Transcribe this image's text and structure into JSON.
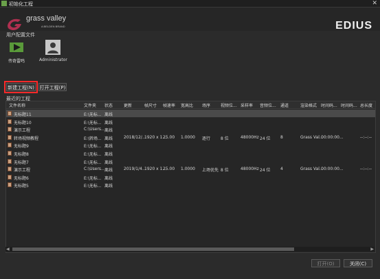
{
  "window": {
    "title": "初始化工程",
    "close": "✕"
  },
  "brand": {
    "name": "grass valley",
    "sub": "A BELDEN BRAND",
    "product": "EDIUS"
  },
  "profiles": {
    "section_label": "用户配置文件",
    "items": [
      {
        "label": "传奇雷鸣"
      },
      {
        "label": "Administrator"
      }
    ]
  },
  "actions": {
    "new_project": "新建工程(N)",
    "open_project": "打开工程(P)"
  },
  "recent": {
    "section_label": "最近的工程",
    "columns": [
      "文件名称",
      "文件夹",
      "状态",
      "更新",
      "帧尺寸",
      "帧速率",
      "宽高比",
      "场序",
      "视频位...",
      "采样率",
      "音频位...",
      "通道",
      "渲染格式",
      "时间码...",
      "时间码...",
      "总长度"
    ],
    "rows": [
      {
        "name": "无标题11",
        "folder": "E:\\无标...",
        "status": "离线",
        "updated": "",
        "frame": "",
        "rate": "",
        "aspect": "",
        "field": "",
        "vbit": "",
        "sample": "",
        "abit": "",
        "ch": "",
        "render": "",
        "tc1": "",
        "tc2": "",
        "total": ""
      },
      {
        "name": "无标题10",
        "folder": "E:\\无标...",
        "status": "离线",
        "updated": "",
        "frame": "",
        "rate": "",
        "aspect": "",
        "field": "",
        "vbit": "",
        "sample": "",
        "abit": "",
        "ch": "",
        "render": "",
        "tc1": "",
        "tc2": "",
        "total": ""
      },
      {
        "name": "演示工程",
        "folder": "C:\\Users...",
        "status": "离线",
        "updated": "",
        "frame": "",
        "rate": "",
        "aspect": "",
        "field": "",
        "vbit": "",
        "sample": "",
        "abit": "",
        "ch": "",
        "render": "",
        "tc1": "",
        "tc2": "",
        "total": ""
      },
      {
        "name": "转场视频教程",
        "folder": "E:\\转场...",
        "status": "离线",
        "updated": "2018/12/...",
        "frame": "1920 x 1...",
        "rate": "25.00",
        "aspect": "1.0000",
        "field": "逐行",
        "vbit": "8 位",
        "sample": "48000Hz",
        "abit": "24 位",
        "ch": "8",
        "render": "Grass Val...",
        "tc1": "00:00:00...",
        "tc2": "",
        "total": "--:--:--"
      },
      {
        "name": "无标题9",
        "folder": "E:\\无标...",
        "status": "离线",
        "updated": "",
        "frame": "",
        "rate": "",
        "aspect": "",
        "field": "",
        "vbit": "",
        "sample": "",
        "abit": "",
        "ch": "",
        "render": "",
        "tc1": "",
        "tc2": "",
        "total": ""
      },
      {
        "name": "无标题8",
        "folder": "E:\\无标...",
        "status": "离线",
        "updated": "",
        "frame": "",
        "rate": "",
        "aspect": "",
        "field": "",
        "vbit": "",
        "sample": "",
        "abit": "",
        "ch": "",
        "render": "",
        "tc1": "",
        "tc2": "",
        "total": ""
      },
      {
        "name": "无标题7",
        "folder": "E:\\无标...",
        "status": "离线",
        "updated": "",
        "frame": "",
        "rate": "",
        "aspect": "",
        "field": "",
        "vbit": "",
        "sample": "",
        "abit": "",
        "ch": "",
        "render": "",
        "tc1": "",
        "tc2": "",
        "total": ""
      },
      {
        "name": "演示工程",
        "folder": "C:\\Users...",
        "status": "离线",
        "updated": "2019/1/4...",
        "frame": "1920 x 1...",
        "rate": "25.00",
        "aspect": "1.0000",
        "field": "上场优先",
        "vbit": "8 位",
        "sample": "48000Hz",
        "abit": "24 位",
        "ch": "4",
        "render": "Grass Val...",
        "tc1": "00:00:00...",
        "tc2": "",
        "total": "--:--:--"
      },
      {
        "name": "无标题6",
        "folder": "E:\\无标...",
        "status": "离线",
        "updated": "",
        "frame": "",
        "rate": "",
        "aspect": "",
        "field": "",
        "vbit": "",
        "sample": "",
        "abit": "",
        "ch": "",
        "render": "",
        "tc1": "",
        "tc2": "",
        "total": ""
      },
      {
        "name": "无标题5",
        "folder": "E:\\无标...",
        "status": "离线",
        "updated": "",
        "frame": "",
        "rate": "",
        "aspect": "",
        "field": "",
        "vbit": "",
        "sample": "",
        "abit": "",
        "ch": "",
        "render": "",
        "tc1": "",
        "tc2": "",
        "total": ""
      }
    ]
  },
  "footer": {
    "open": "打开(O)",
    "close": "关闭(C)"
  },
  "scroll": {
    "left": "◀",
    "right": "▶"
  }
}
